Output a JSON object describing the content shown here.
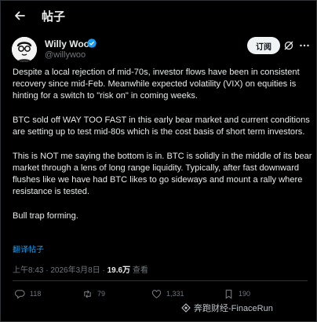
{
  "header": {
    "title": "帖子"
  },
  "author": {
    "name": "Willy Woo",
    "handle": "@willywoo",
    "subscribe_label": "订阅"
  },
  "post": {
    "paragraphs": [
      "Despite a local rejection of mid-70s, investor flows have been in consistent recovery since mid-Feb. Meanwhile expected volatility (VIX) on equities is hinting for a switch to \"risk on\" in coming weeks.",
      "BTC sold off WAY TOO FAST in this early bear market and current conditions are setting up to test mid-80s which is the cost basis of short term investors.",
      "This is NOT me saying the bottom is in. BTC is solidly in the middle of its bear market through a lens of long range liquidity. Typically, after fast downward flushes like we have had BTC likes to go sideways and mount a rally where resistance is tested.",
      "Bull trap forming."
    ],
    "translate_label": "翻译帖子",
    "time": "上午8:43 · 2026年3月8日 · ",
    "views_count": "19.6万",
    "views_label": " 查看"
  },
  "actions": {
    "replies": "118",
    "reposts": "79",
    "likes": "1,331",
    "bookmarks": "190"
  },
  "watermark": "奔跑财经-FinaceRun",
  "colors": {
    "accent": "#1d9bf0",
    "muted": "#71767b",
    "text": "#e7e9ea",
    "background": "#000000"
  }
}
